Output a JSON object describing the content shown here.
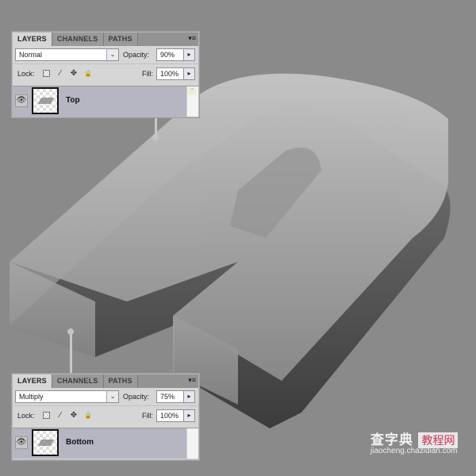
{
  "panels": {
    "top": {
      "tabs": [
        "LAYERS",
        "CHANNELS",
        "PATHS"
      ],
      "active_tab": "LAYERS",
      "menu_icon": "panel-menu-icon",
      "blend_mode": "Normal",
      "opacity_label": "Opacity:",
      "opacity_value": "90%",
      "lock_label": "Lock:",
      "fill_label": "Fill:",
      "fill_value": "100%",
      "layer_name": "Top"
    },
    "bottom": {
      "tabs": [
        "LAYERS",
        "CHANNELS",
        "PATHS"
      ],
      "active_tab": "LAYERS",
      "menu_icon": "panel-menu-icon",
      "blend_mode": "Multiply",
      "opacity_label": "Opacity:",
      "opacity_value": "75%",
      "lock_label": "Lock:",
      "fill_label": "Fill:",
      "fill_value": "100%",
      "layer_name": "Bottom"
    }
  },
  "glyphs": {
    "dropdown": "⌄",
    "step": "▸",
    "eye": "👁",
    "brush": "⁄",
    "move": "✥",
    "lock": "🔒",
    "menu": "▾≡",
    "scroll_up": "⌃"
  },
  "watermark": {
    "site_name_cn": "查字典",
    "section_cn": "教程网",
    "url": "jiaocheng.chazidian.com"
  },
  "colors": {
    "background": "#8a8a8a",
    "panel": "#d6d6d6",
    "layer_selected": "#b5b6c2",
    "letter_top": "#c4c4c4",
    "letter_bottom": "#3e3e3e"
  }
}
